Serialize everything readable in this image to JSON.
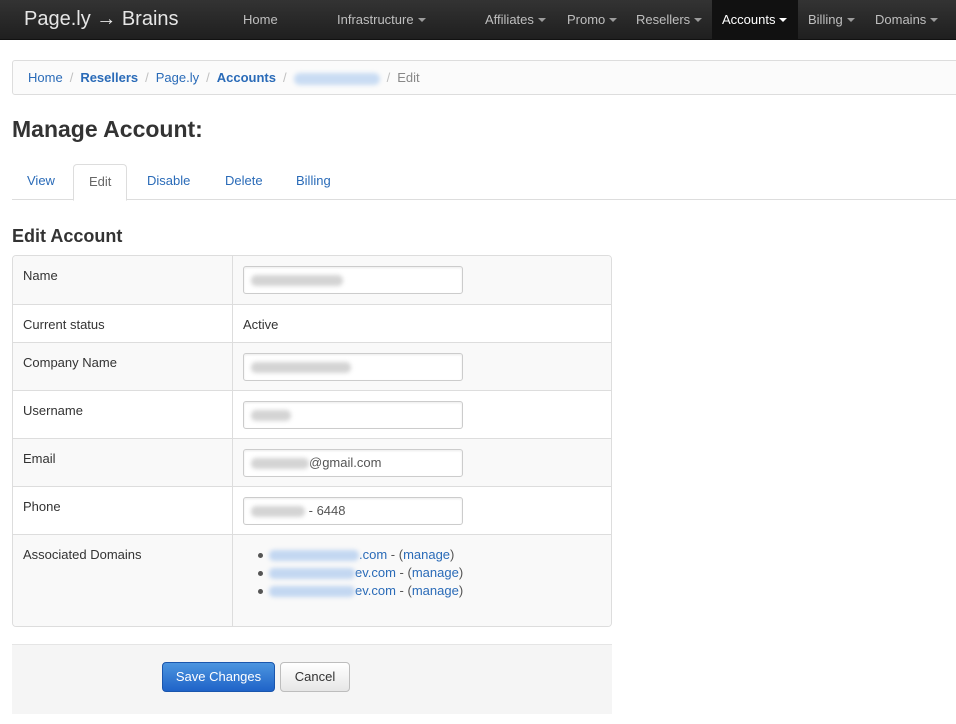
{
  "navbar": {
    "brand": "Page.ly → Brains",
    "items": [
      {
        "label": "Home",
        "dropdown": false,
        "active": false
      },
      {
        "label": "Infrastructure",
        "dropdown": true,
        "active": false
      },
      {
        "label": "Affiliates",
        "dropdown": true,
        "active": false
      },
      {
        "label": "Promo",
        "dropdown": true,
        "active": false
      },
      {
        "label": "Resellers",
        "dropdown": true,
        "active": false
      },
      {
        "label": "Accounts",
        "dropdown": true,
        "active": true
      },
      {
        "label": "Billing",
        "dropdown": true,
        "active": false
      },
      {
        "label": "Domains",
        "dropdown": true,
        "active": false
      }
    ]
  },
  "breadcrumb": {
    "items": [
      "Home",
      "Resellers",
      "Page.ly",
      "Accounts"
    ],
    "current": "Edit"
  },
  "page": {
    "title": "Manage Account:"
  },
  "tabs": [
    {
      "label": "View",
      "active": false
    },
    {
      "label": "Edit",
      "active": true
    },
    {
      "label": "Disable",
      "active": false
    },
    {
      "label": "Delete",
      "active": false
    },
    {
      "label": "Billing",
      "active": false
    }
  ],
  "form": {
    "title": "Edit Account",
    "fields": {
      "name_label": "Name",
      "status_label": "Current status",
      "status_value": "Active",
      "company_label": "Company Name",
      "username_label": "Username",
      "email_label": "Email",
      "email_visible_suffix": "@gmail.com",
      "phone_label": "Phone",
      "phone_visible_suffix": "- 6448",
      "domains_label": "Associated Domains"
    },
    "domains": [
      {
        "visible_suffix": ".com",
        "separator": " - (",
        "manage": "manage",
        "close": ")"
      },
      {
        "visible_suffix": "ev.com",
        "separator": " - (",
        "manage": "manage",
        "close": ")"
      },
      {
        "visible_suffix": "ev.com",
        "separator": " - (",
        "manage": "manage",
        "close": ")"
      }
    ]
  },
  "actions": {
    "save_label": "Save Changes",
    "cancel_label": "Cancel"
  },
  "colors": {
    "link": "#2a6bb8",
    "navbar_bg": "#222222",
    "primary_button": "#1f63c8"
  }
}
